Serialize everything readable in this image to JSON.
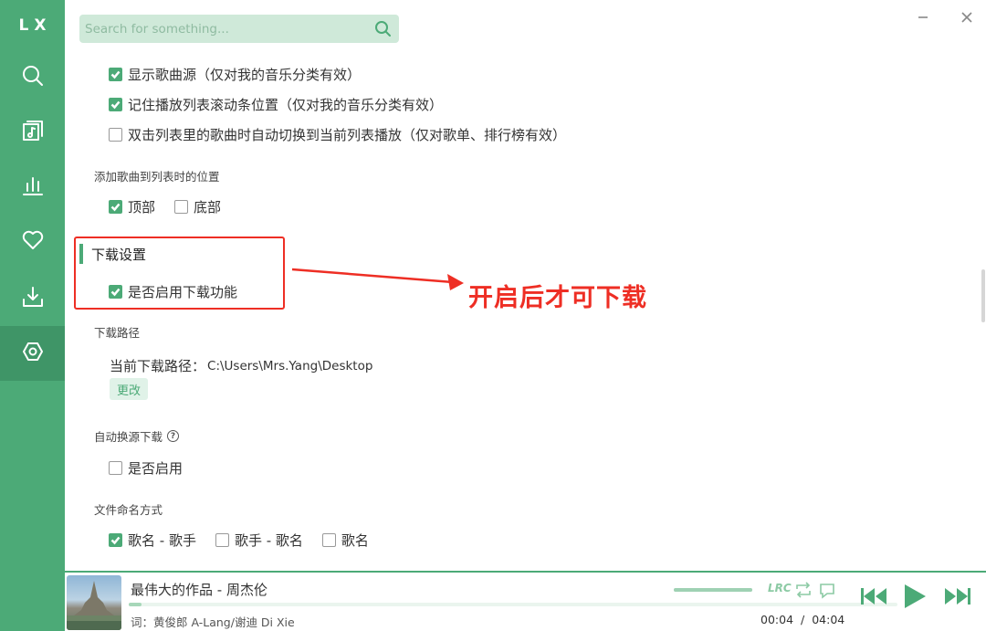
{
  "app": {
    "logo": "LX"
  },
  "sidebar": {
    "items": [
      {
        "icon": "search-icon",
        "active": false
      },
      {
        "icon": "music-list-icon",
        "active": false
      },
      {
        "icon": "chart-bars-icon",
        "active": false
      },
      {
        "icon": "heart-icon",
        "active": false
      },
      {
        "icon": "download-icon",
        "active": false
      },
      {
        "icon": "settings-icon",
        "active": true
      }
    ]
  },
  "search": {
    "placeholder": "Search for something..."
  },
  "settings": {
    "list_options": [
      {
        "label": "显示歌曲源（仅对我的音乐分类有效）",
        "checked": true
      },
      {
        "label": "记住播放列表滚动条位置（仅对我的音乐分类有效）",
        "checked": true
      },
      {
        "label": "双击列表里的歌曲时自动切换到当前列表播放（仅对歌单、排行榜有效）",
        "checked": false
      }
    ],
    "add_position": {
      "title": "添加歌曲到列表时的位置",
      "options": [
        {
          "label": "顶部",
          "checked": true
        },
        {
          "label": "底部",
          "checked": false
        }
      ]
    },
    "download": {
      "title": "下载设置",
      "enable": {
        "label": "是否启用下载功能",
        "checked": true
      },
      "path_title": "下载路径",
      "path_label": "当前下载路径：",
      "path_value": "C:\\Users\\Mrs.Yang\\Desktop",
      "change_label": "更改",
      "auto_switch_title": "自动换源下载",
      "auto_switch_help": "?",
      "auto_switch": {
        "label": "是否启用",
        "checked": false
      },
      "naming_title": "文件命名方式",
      "naming_options": [
        {
          "label": "歌名 - 歌手",
          "checked": true
        },
        {
          "label": "歌手 - 歌名",
          "checked": false
        },
        {
          "label": "歌名",
          "checked": false
        }
      ]
    }
  },
  "annotation": {
    "text": "开启后才可下载",
    "color": "#ee2e24"
  },
  "player": {
    "title": "最伟大的作品 - 周杰伦",
    "lyric": "词：黄俊郎 A-Lang/谢迪 Di Xie",
    "current_time": "00:04",
    "separator": "/",
    "total_time": "04:04",
    "progress": 0.017,
    "volume": 1.0,
    "lrc_label": "LRC"
  },
  "colors": {
    "accent": "#4caa77",
    "accent_dark": "#3f9567",
    "annotation": "#ee2e24"
  }
}
